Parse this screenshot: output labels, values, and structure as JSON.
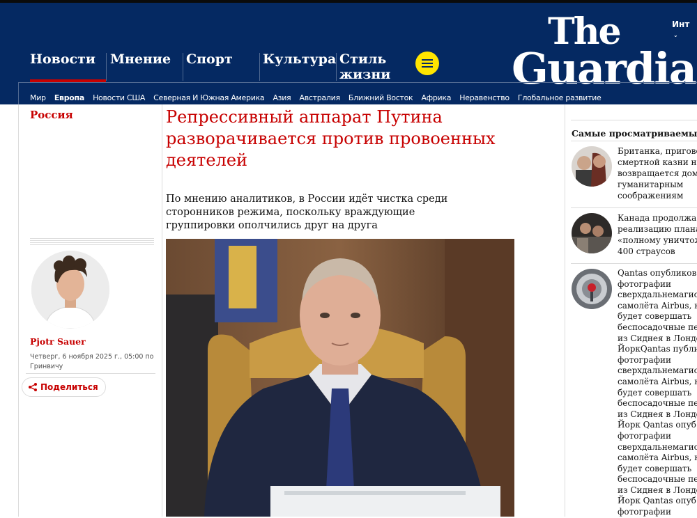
{
  "header": {
    "edition": "Инт",
    "logo": {
      "line1": "The",
      "line2": "Guardian"
    },
    "pillars": [
      "Новости",
      "Мнение",
      "Спорт",
      "Культура",
      "Стиль жизни"
    ],
    "subnav": [
      "Мир",
      "Европа",
      "Новости США",
      "Северная И Южная Америка",
      "Азия",
      "Австралия",
      "Ближний Восток",
      "Африка",
      "Неравенство",
      "Глобальное развитие"
    ],
    "subnav_active": "Европа"
  },
  "article": {
    "section": "Россия",
    "headline": "Репрессивный аппарат Путина разворачивается против провоенных деятелей",
    "standfirst": "По мнению аналитиков, в России идёт чистка среди сторонников режима, поскольку враждующие группировки ополчились друг на друга",
    "author": "Pjotr Sauer",
    "dateline": "Четверг, 6 ноября 2025 г., 05:00 по Гринвичу",
    "share_label": "Поделиться"
  },
  "most_viewed": {
    "title": "Самые просматриваемые",
    "items": [
      {
        "text": "Британка, пригово\nсмертной казни на\nвозвращается дом\nгуманитарным\nсоображениям"
      },
      {
        "text": "Канада продолжа\nреализацию плана\n«полному уничтож\n400 страусов"
      },
      {
        "text": "Qantas опубликов\nфотографии\nсверхдальнемагис\nсамолёта Airbus, к\nбудет совершать\nбеспосадочные пе\nиз Сиднея в Лондо\nЙоркQantas публи\nфотографии\nсверхдальнемагис\nсамолёта Airbus, к\nбудет совершать\nбеспосадочные пе\nиз Сиднея в Лондо\nЙорк Qantas опуб\nфотографии\nсверхдальнемагис\nсамолёта Airbus, к\nбудет совершать\nбеспосадочные пе\nиз Сиднея в Лондо\nЙорк Qantas опуб\nфотографии"
      }
    ]
  },
  "colors": {
    "brand": "#052962",
    "accent": "#c70000",
    "menu_button": "#ffe500"
  }
}
